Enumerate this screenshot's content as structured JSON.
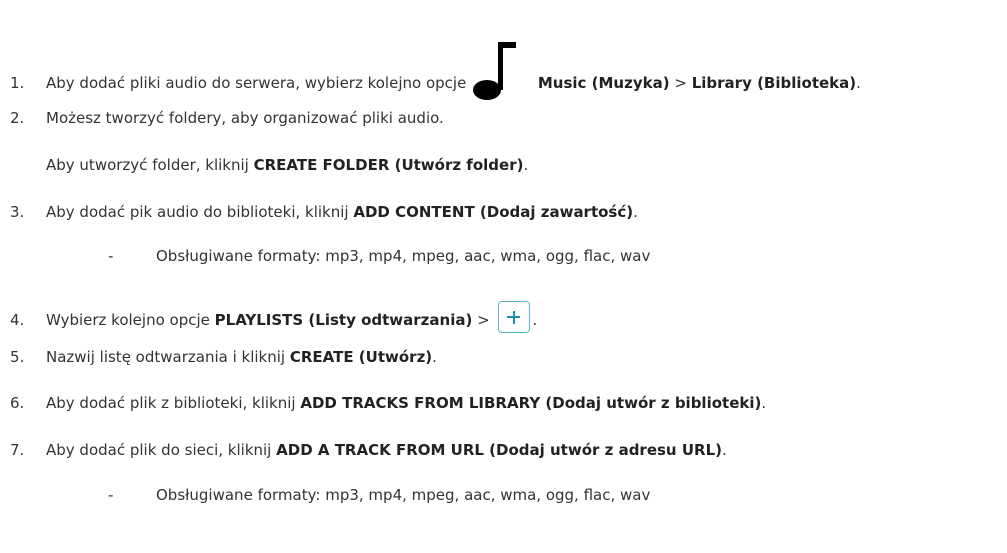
{
  "steps": [
    {
      "num": "1.",
      "text": "Aby dodać pliki audio do serwera, wybierz kolejno opcje",
      "icon": "music-note-icon",
      "b1": "Music (Muzyka)",
      "sep": ">",
      "b2": "Library (Biblioteka)",
      "end": "."
    },
    {
      "num": "2.",
      "text": "Możesz tworzyć foldery, aby organizować pliki audio.",
      "sub_text": "Aby utworzyć folder, kliknij",
      "sub_bold": "CREATE FOLDER (Utwórz folder)",
      "sub_end": "."
    },
    {
      "num": "3.",
      "text": "Aby dodać pik audio do biblioteki, kliknij",
      "bold": "ADD CONTENT (Dodaj zawartość)",
      "end": ".",
      "bullet": "Obsługiwane formaty: mp3, mp4, mpeg, aac, wma, ogg, flac, wav"
    },
    {
      "num": "4.",
      "text": "Wybierz kolejno opcje",
      "bold": "PLAYLISTS (Listy odtwarzania)",
      "sep": ">",
      "icon": "plus-icon",
      "end": "."
    },
    {
      "num": "5.",
      "text": "Nazwij listę odtwarzania i kliknij",
      "bold": "CREATE (Utwórz)",
      "end": "."
    },
    {
      "num": "6.",
      "text": "Aby dodać plik z biblioteki, kliknij",
      "bold": "ADD TRACKS FROM LIBRARY (Dodaj utwór z biblioteki)",
      "end": "."
    },
    {
      "num": "7.",
      "text": "Aby dodać plik do sieci, kliknij",
      "bold": "ADD A TRACK FROM URL (Dodaj utwór z adresu URL)",
      "end": ".",
      "bullet": "Obsługiwane formaty: mp3, mp4, mpeg, aac, wma, ogg, flac, wav"
    }
  ],
  "bullet_dash": "-",
  "colors": {
    "text": "#333333",
    "button_border": "#5ab7c9",
    "button_plus": "#1f8fa8"
  }
}
